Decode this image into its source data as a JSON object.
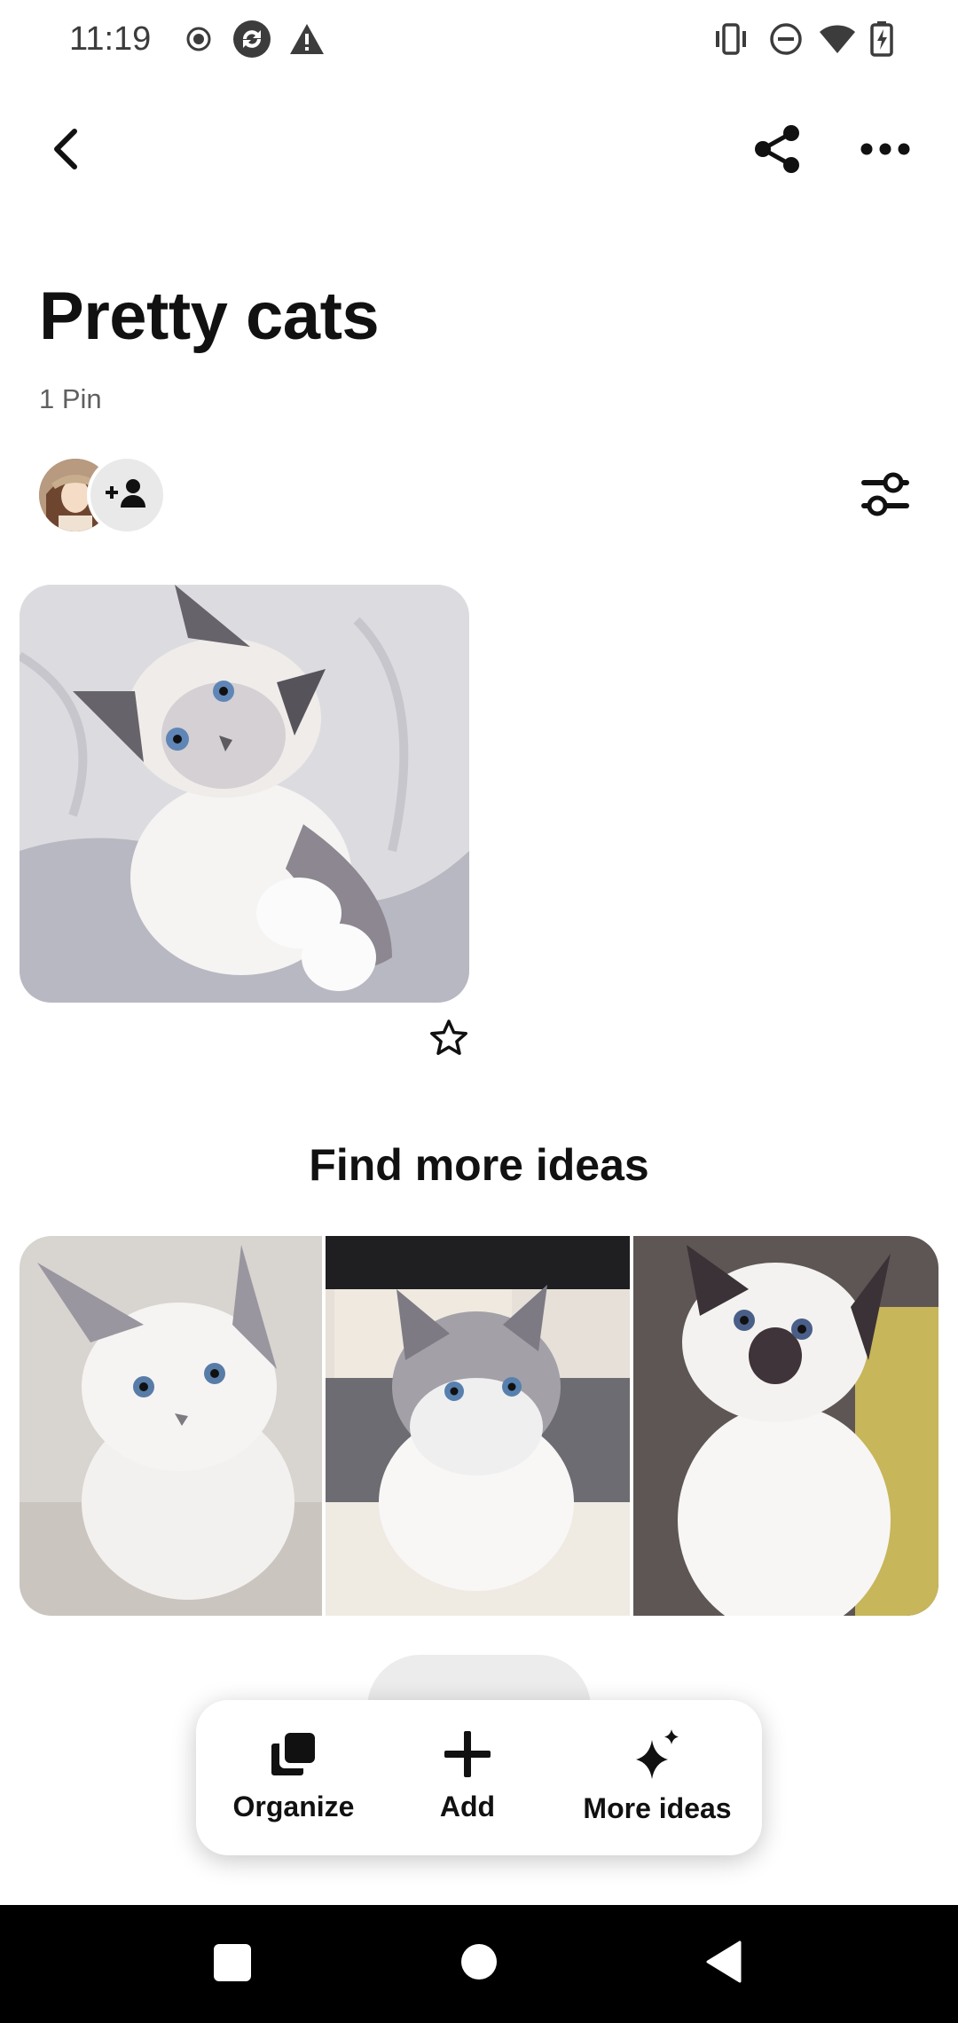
{
  "status_bar": {
    "time": "11:19",
    "left_icons": [
      "record-icon",
      "sync-icon",
      "warning-icon"
    ],
    "right_icons": [
      "vibrate-icon",
      "do-not-disturb-icon",
      "wifi-icon",
      "battery-charging-icon"
    ]
  },
  "top_bar": {
    "icons": [
      "back-arrow-icon",
      "share-icon",
      "more-options-icon"
    ]
  },
  "board": {
    "title": "Pretty cats",
    "pin_count": "1 Pin",
    "filter_icon": "sliders-icon"
  },
  "pins": [
    {
      "subject": "ragdoll kitten lying on bed",
      "favorite_icon": "star-outline-icon"
    }
  ],
  "more_ideas": {
    "title": "Find more ideas"
  },
  "action_bar": {
    "organize_label": "Organize",
    "add_label": "Add",
    "more_ideas_label": "More ideas"
  },
  "nav_bar": {
    "icons": [
      "recents-square-icon",
      "home-circle-icon",
      "back-triangle-icon"
    ]
  },
  "colors": {
    "text": "#111111",
    "muted": "#5f5f5f",
    "nav_bg": "#000000"
  }
}
